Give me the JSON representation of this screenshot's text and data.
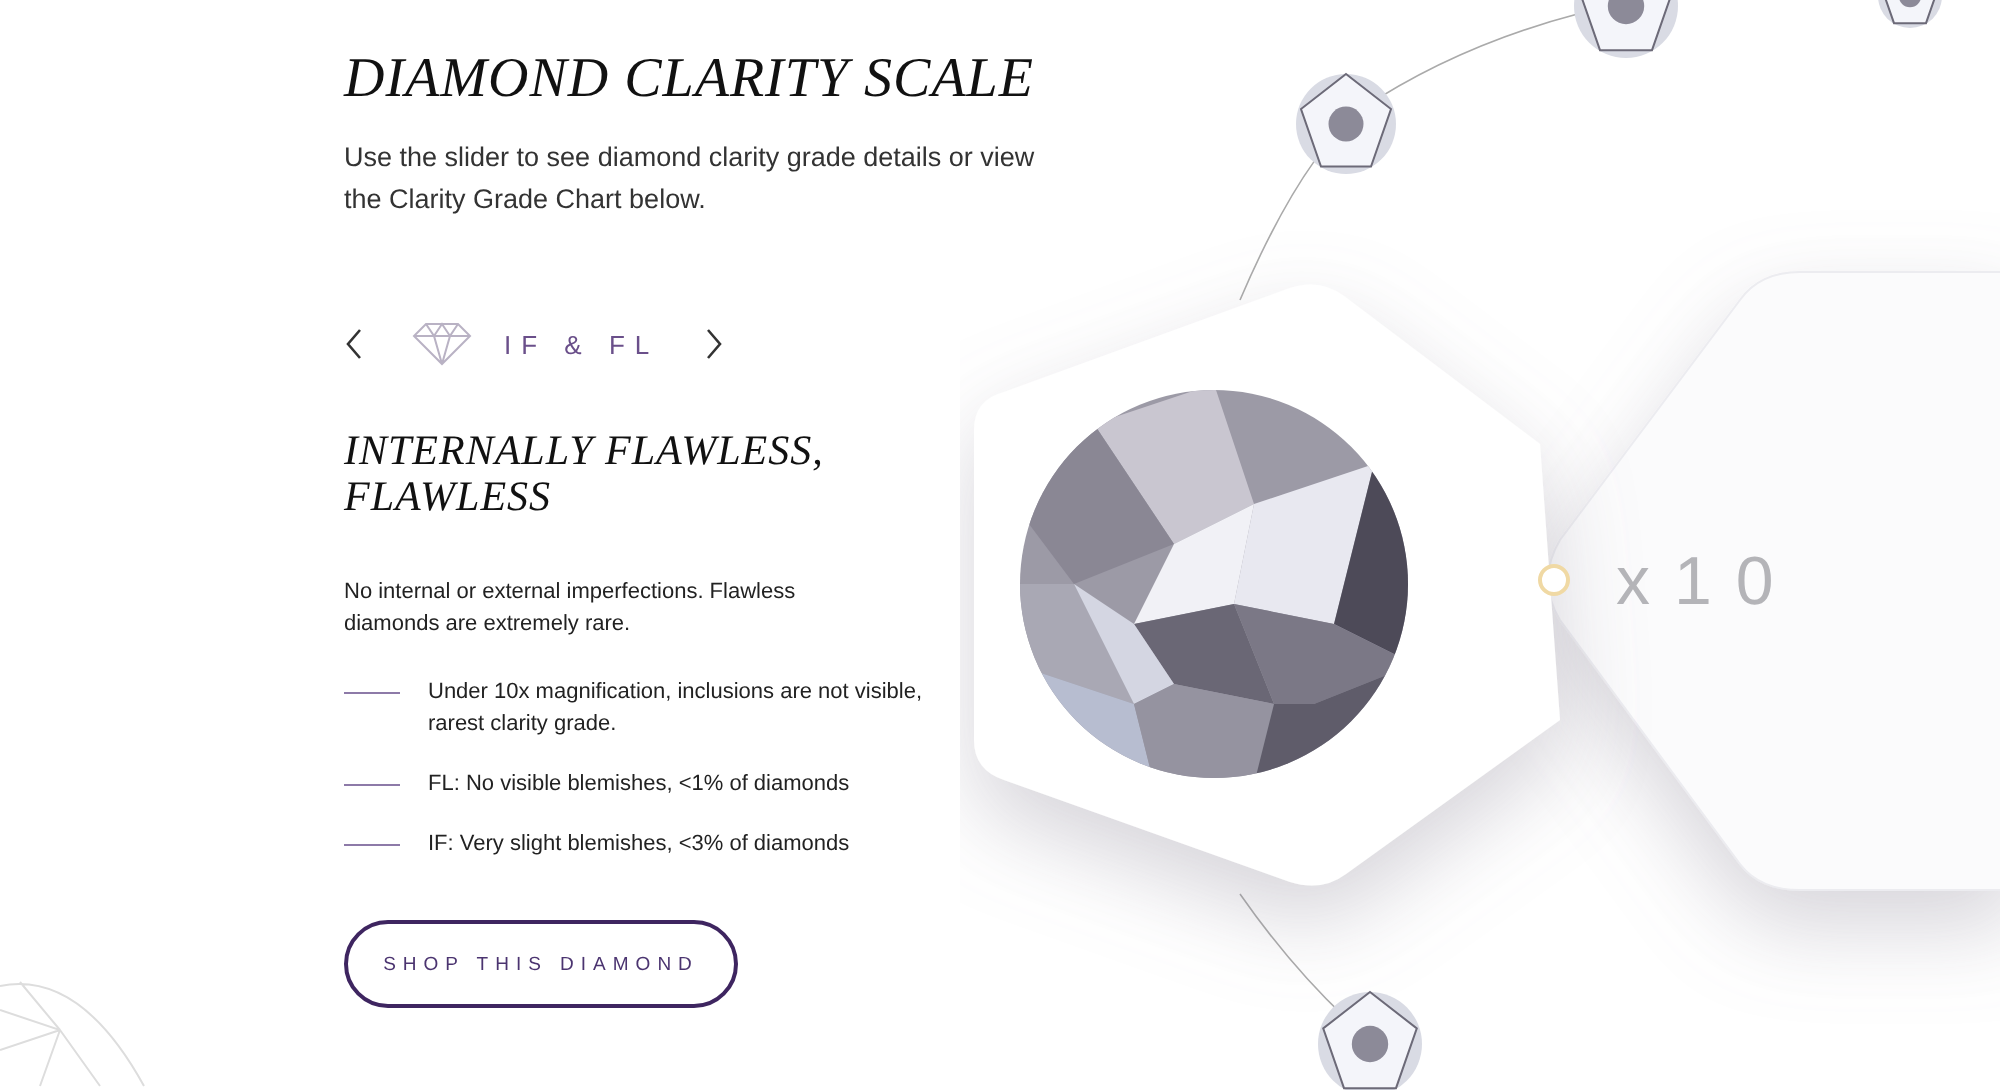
{
  "title": "DIAMOND CLARITY SCALE",
  "intro": "Use the slider to see diamond clarity grade details or view the Clarity Grade Chart below.",
  "selector": {
    "grade": "IF & FL"
  },
  "grade_title": "INTERNALLY FLAWLESS, FLAWLESS",
  "description": "No internal or external imperfections. Flawless diamonds are extremely rare.",
  "details": [
    "Under 10x magnification, inclusions are not visible, rarest clarity grade.",
    "FL: No visible blemishes, <1% of diamonds",
    "IF: Very slight blemishes, <3% of diamonds"
  ],
  "button": "SHOP THIS DIAMOND",
  "magnification": "x10"
}
